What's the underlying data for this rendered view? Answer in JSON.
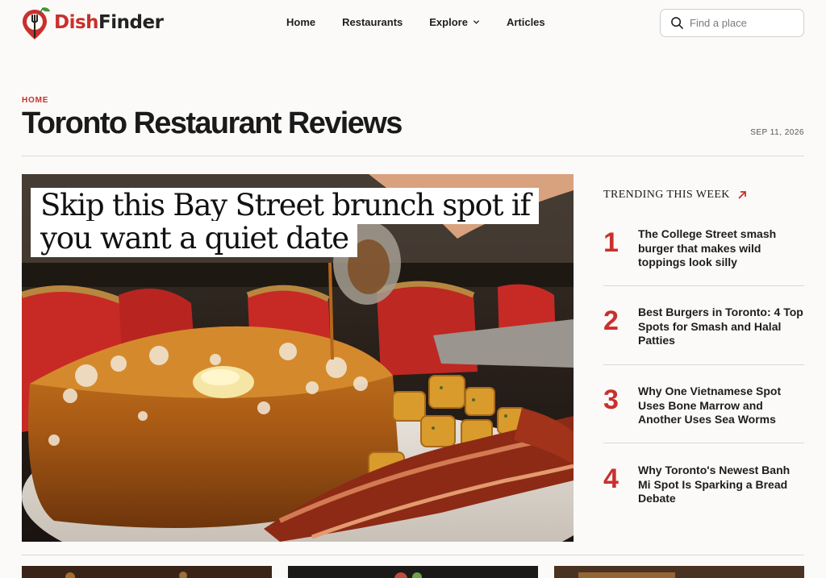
{
  "brand": {
    "dish": "Dish",
    "finder": "Finder",
    "accent": "#c9302c"
  },
  "nav": {
    "items": [
      {
        "label": "Home"
      },
      {
        "label": "Restaurants"
      },
      {
        "label": "Explore"
      },
      {
        "label": "Articles"
      }
    ]
  },
  "search": {
    "placeholder": "Find a place",
    "icon": "search-icon"
  },
  "breadcrumb": "HOME",
  "page_title": "Toronto Restaurant Reviews",
  "date": "SEP 11, 2026",
  "hero": {
    "headline": "Skip this Bay Street brunch spot if you want a quiet date"
  },
  "trending": {
    "heading": "TRENDING THIS WEEK",
    "icon": "arrow-up-right-icon",
    "items": [
      {
        "rank": "1",
        "title": "The College Street smash burger that makes wild toppings look silly"
      },
      {
        "rank": "2",
        "title": "Best Burgers in Toronto: 4 Top Spots for Smash and Halal Patties"
      },
      {
        "rank": "3",
        "title": "Why One Vietnamese Spot Uses Bone Marrow and Another Uses Sea Worms"
      },
      {
        "rank": "4",
        "title": "Why Toronto's Newest Banh Mi Spot Is Sparking a Bread Debate"
      }
    ]
  }
}
